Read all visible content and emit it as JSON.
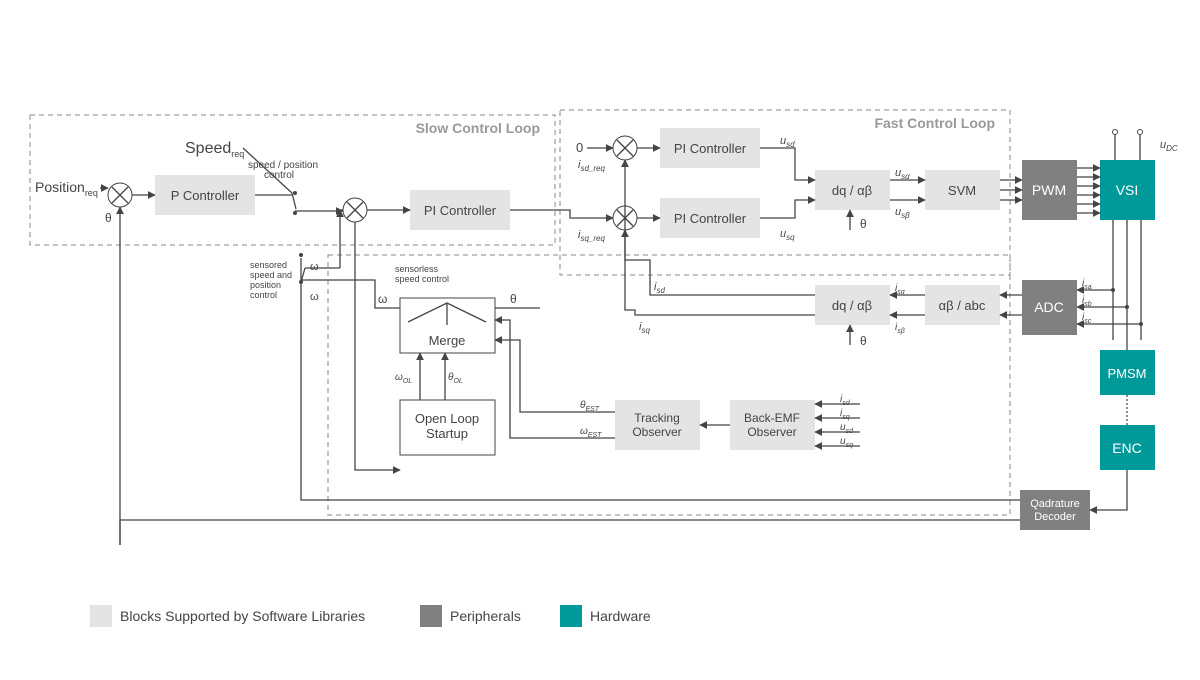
{
  "groups": {
    "slow": "Slow Control Loop",
    "fast": "Fast Control Loop"
  },
  "blocks": {
    "pctrl": "P Controller",
    "pi_speed": "PI Controller",
    "pi_id": "PI Controller",
    "pi_iq": "PI Controller",
    "dq_ab_fwd": "dq / αβ",
    "dq_ab_inv": "dq / αβ",
    "ab_abc": "αβ / abc",
    "svm": "SVM",
    "pwm": "PWM",
    "adc": "ADC",
    "vsi": "VSI",
    "pmsm": "PMSM",
    "enc": "ENC",
    "qdec_l1": "Qadrature",
    "qdec_l2": "Decoder",
    "merge": "Merge",
    "ols_l1": "Open Loop",
    "ols_l2": "Startup",
    "track_l1": "Tracking",
    "track_l2": "Observer",
    "bemf_l1": "Back-EMF",
    "bemf_l2": "Observer"
  },
  "inputs": {
    "speed_lbl": "Speed",
    "speed_sub": "req",
    "pos_lbl": "Position",
    "pos_sub": "req",
    "theta_fb": "θ",
    "zero": "0",
    "isd_req_a": "i",
    "isd_req_b": "sd_req",
    "isq_req_a": "i",
    "isq_req_b": "sq_req"
  },
  "signals": {
    "usd": "u",
    "usd_s": "sd",
    "usq": "u",
    "usq_s": "sq",
    "usa": "u",
    "usa_s": "sα",
    "usb": "u",
    "usb_s": "sβ",
    "udc": "u",
    "udc_s": "DC",
    "isa": "i",
    "isa_s": "sα",
    "isb": "i",
    "isb_s": "sβ",
    "ia": "i",
    "ia_s": "sa",
    "ib": "i",
    "ib_s": "sb",
    "ic": "i",
    "ic_s": "sc",
    "isd": "i",
    "isd_s": "sd",
    "isq": "i",
    "isq_s": "sq",
    "theta1": "θ",
    "theta2": "θ",
    "theta_m": "θ",
    "omega_m": "ω",
    "omega_ol": "ω",
    "omega_ol_s": "OL",
    "theta_ol": "θ",
    "theta_ol_s": "OL",
    "theta_est": "θ",
    "theta_est_s": "EST",
    "omega_est": "ω",
    "omega_est_s": "EST",
    "sw_lbl_a": "speed / position",
    "sw_lbl_b": "control",
    "sensored_a": "sensored",
    "sensored_b": "speed  and",
    "sensored_c": "position",
    "sensored_d": "control",
    "sensorless_a": "sensorless",
    "sensorless_b": "speed  control",
    "bemf_isd": "i",
    "bemf_isd_s": "sd",
    "bemf_isq": "i",
    "bemf_isq_s": "sq",
    "bemf_usd": "u",
    "bemf_usd_s": "sd",
    "bemf_usq": "u",
    "bemf_usq_s": "sq"
  },
  "legend": {
    "sw": "Blocks Supported by Software Libraries",
    "peri": "Peripherals",
    "hw": "Hardware"
  }
}
